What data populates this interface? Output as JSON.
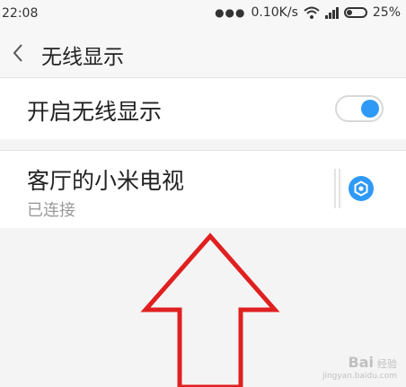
{
  "status_bar": {
    "time": "22:08",
    "network_speed": "0.10K/s",
    "battery_percent": "25%",
    "battery_level": 0.25
  },
  "header": {
    "title": "无线显示"
  },
  "wireless_display": {
    "label": "开启无线显示",
    "enabled": true
  },
  "devices": [
    {
      "name": "客厅的小米电视",
      "status": "已连接"
    }
  ],
  "colors": {
    "accent": "#2f9af5",
    "annotation": "#e02020"
  },
  "watermark": {
    "main": "Bai",
    "sub": "经验",
    "url": "jingyan.baidu.com"
  }
}
